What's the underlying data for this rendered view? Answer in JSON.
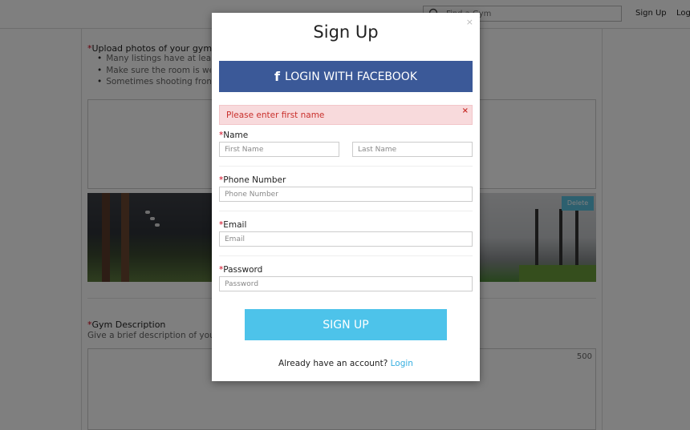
{
  "topbar": {
    "search_placeholder": "Find a Gym",
    "signup_link": "Sign Up",
    "login_link": "Log"
  },
  "background": {
    "upload": {
      "required_mark": "*",
      "title": "Upload photos of your gym",
      "tips": [
        "Many listings have at least",
        "Make sure the room is well",
        "Sometimes shooting from"
      ]
    },
    "photo_delete_label": "Delete",
    "description": {
      "required_mark": "*",
      "title": "Gym Description",
      "subtitle": "Give a brief description of your",
      "char_count": "500"
    }
  },
  "modal": {
    "close_icon": "×",
    "title": "Sign Up",
    "facebook_icon": "f",
    "facebook_label": "LOGIN WITH FACEBOOK",
    "alert_text": "Please enter first name",
    "alert_close": "×",
    "required_mark": "*",
    "name_label": "Name",
    "first_name_placeholder": "First Name",
    "last_name_placeholder": "Last Name",
    "phone_label": "Phone Number",
    "phone_placeholder": "Phone Number",
    "email_label": "Email",
    "email_placeholder": "Email",
    "password_label": "Password",
    "password_placeholder": "Password",
    "submit_label": "SIGN UP",
    "already_text": "Already have an account?",
    "login_link": "Login"
  },
  "colors": {
    "facebook_blue": "#3b5998",
    "signup_blue": "#4dc3ea",
    "alert_bg": "#f8dadc",
    "alert_text": "#c9302c",
    "required_red": "#d0021b",
    "link_blue": "#35aee0"
  },
  "icons": [
    "search-icon",
    "facebook-icon",
    "close-icon",
    "alert-close-icon"
  ]
}
